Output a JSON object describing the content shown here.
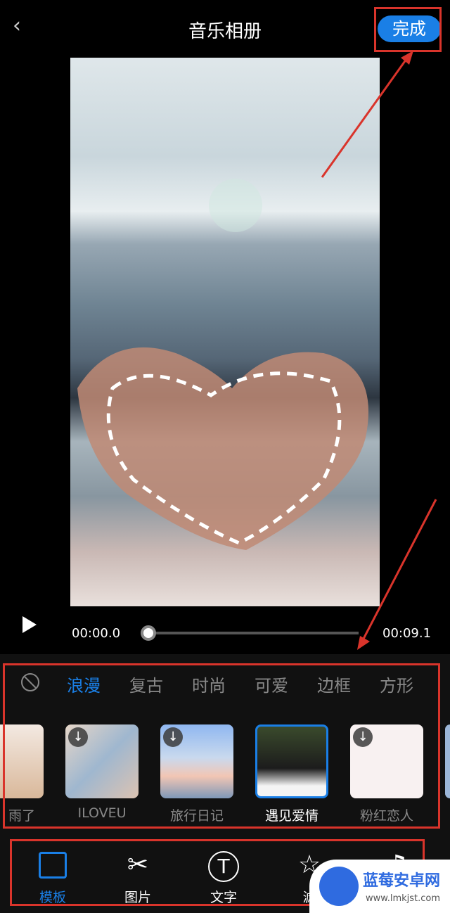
{
  "header": {
    "back_icon": "chevron-left-icon",
    "title": "音乐相册",
    "done_label": "完成"
  },
  "player": {
    "current_time": "00:00.0",
    "total_time": "00:09.1",
    "progress": 0
  },
  "categories": {
    "none_icon": "no-symbol-icon",
    "items": [
      "浪漫",
      "复古",
      "时尚",
      "可爱",
      "边框",
      "方形"
    ],
    "active": "浪漫"
  },
  "templates": [
    {
      "label": "雨了",
      "download": false
    },
    {
      "label": "ILOVEU",
      "download": true
    },
    {
      "label": "旅行日记",
      "download": true
    },
    {
      "label": "遇见爱情",
      "download": false,
      "selected": true
    },
    {
      "label": "粉红恋人",
      "download": true
    }
  ],
  "toolbar": [
    {
      "label": "模板",
      "icon": "template-icon",
      "active": true
    },
    {
      "label": "图片",
      "icon": "scissors-icon"
    },
    {
      "label": "文字",
      "icon": "text-t-icon"
    },
    {
      "label": "滤",
      "icon": "star-filter-icon"
    },
    {
      "label": "",
      "icon": "music-note-icon"
    }
  ],
  "watermark": {
    "name": "蓝莓安卓网",
    "url": "www.lmkjst.com"
  },
  "colors": {
    "accent": "#1a7fe6",
    "annotation": "#d9342b"
  }
}
